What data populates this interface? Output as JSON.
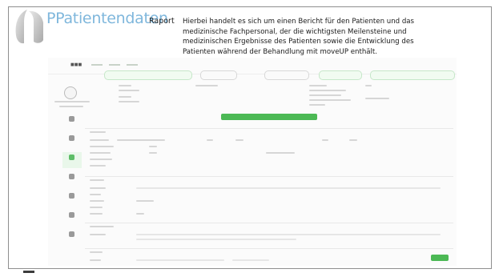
{
  "slide": {
    "title": "PPatientendaten",
    "subtitle": "Raport",
    "description": "Hierbei handelt es sich um einen Bericht für den Patienten und das medizinische Fachpersonal, der die wichtigsten Meilensteine und medizinischen Ergebnisse des Patienten sowie die Entwicklung des Patienten während der Behandlung mit moveUP enthält."
  },
  "colors": {
    "title": "#7fb7dc",
    "accent": "#4cb955"
  }
}
